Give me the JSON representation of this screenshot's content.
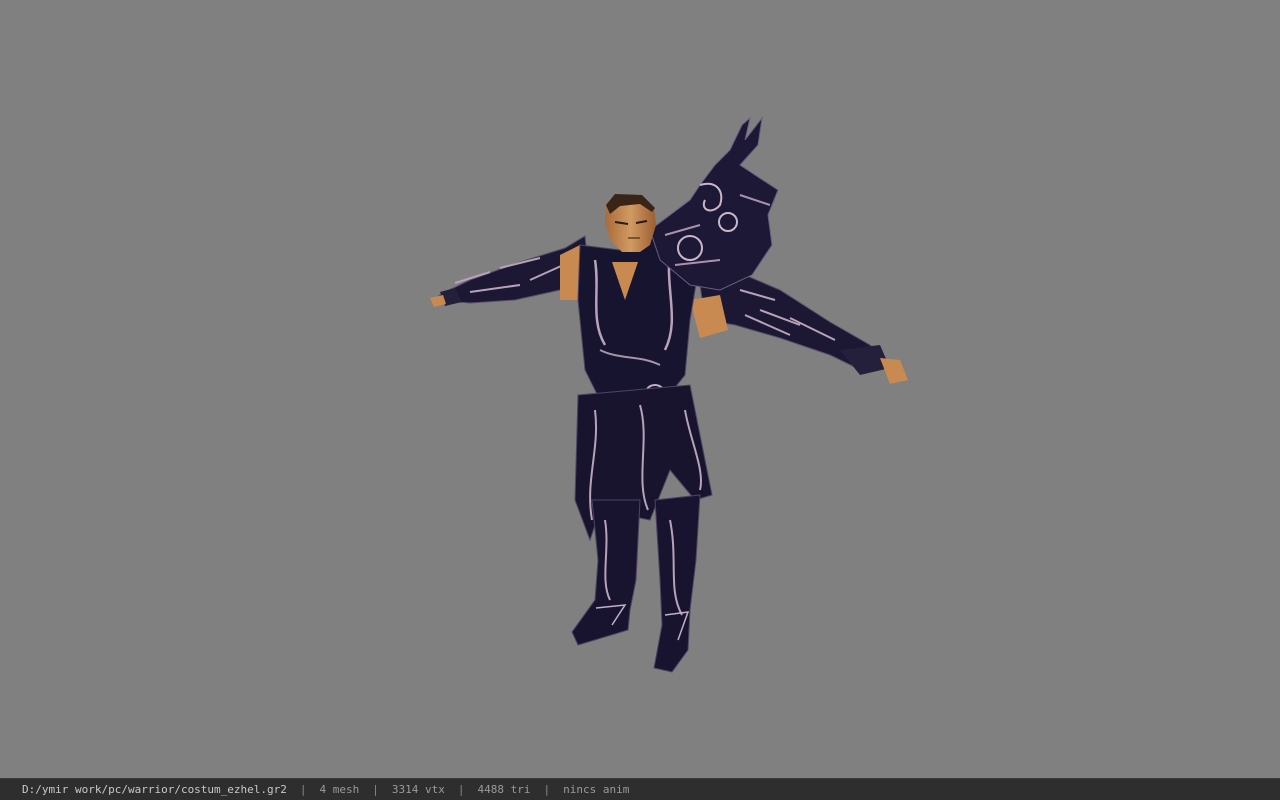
{
  "viewport": {
    "background_color": "#808080",
    "model_name": "warrior-character-model"
  },
  "status_bar": {
    "file_path": "D:/ymir work/pc/warrior/costum_ezhel.gr2",
    "separator": "|",
    "mesh_count": "4 mesh",
    "vertex_count": "3314 vtx",
    "triangle_count": "4488 tri",
    "anim_status": "nincs anim"
  },
  "colors": {
    "armor_dark": "#191530",
    "armor_trim": "#b7a2b8",
    "skin": "#c98a52",
    "hair": "#3a2418",
    "status_bg": "#2e2e2e",
    "status_text": "#9a9a9a"
  }
}
